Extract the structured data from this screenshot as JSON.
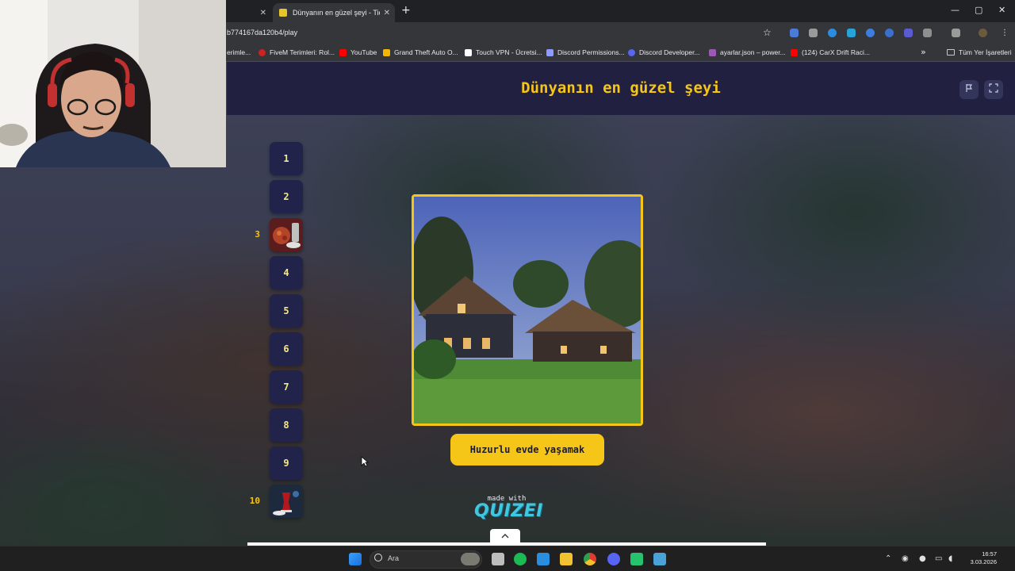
{
  "browser": {
    "tabs": [
      {
        "title": "",
        "close": "✕"
      },
      {
        "title": "Dünyanın en güzel şeyi - Tier L",
        "close": "✕",
        "active": true
      }
    ],
    "new_tab": "+",
    "window_controls": {
      "minimize": "—",
      "maximize": "▢",
      "close": "✕"
    },
    "url": "b774167da120b4/play",
    "star": "☆",
    "bookmarks": [
      {
        "label": "erimle...",
        "color": "#666666"
      },
      {
        "label": "FiveM Terimleri: Rol...",
        "color": "#cc2222"
      },
      {
        "label": "YouTube",
        "color": "#ff0000"
      },
      {
        "label": "Grand Theft Auto O...",
        "color": "#f2b705"
      },
      {
        "label": "Touch VPN - Ücretsi...",
        "color": "#ffffff"
      },
      {
        "label": "Discord Permissions...",
        "color": "#5865f2"
      },
      {
        "label": "Discord Developer...",
        "color": "#5865f2"
      },
      {
        "label": "ayarlar.json – power...",
        "color": "#9b59b6"
      },
      {
        "label": "(124) CarX Drift Raci...",
        "color": "#ff0000"
      }
    ],
    "bookmarks_more": "»",
    "all_bookmarks": "Tüm Yer İşaretleri"
  },
  "quiz": {
    "title": "Dünyanın en güzel şeyi",
    "report_icon": "flag-icon",
    "fullscreen_icon": "fullscreen-icon",
    "tiers": [
      "1",
      "2",
      "3",
      "4",
      "5",
      "6",
      "7",
      "8",
      "9",
      "10"
    ],
    "tier_side_labels": {
      "3": "3",
      "10": "10"
    },
    "current_item_label": "Huzurlu evde yaşamak",
    "made_with": "made with",
    "brand": "QUIZEI",
    "collapse_icon": "chevron-up-icon"
  },
  "taskbar": {
    "search_placeholder": "Ara",
    "time": "16:57",
    "date": "3.03.2026"
  }
}
